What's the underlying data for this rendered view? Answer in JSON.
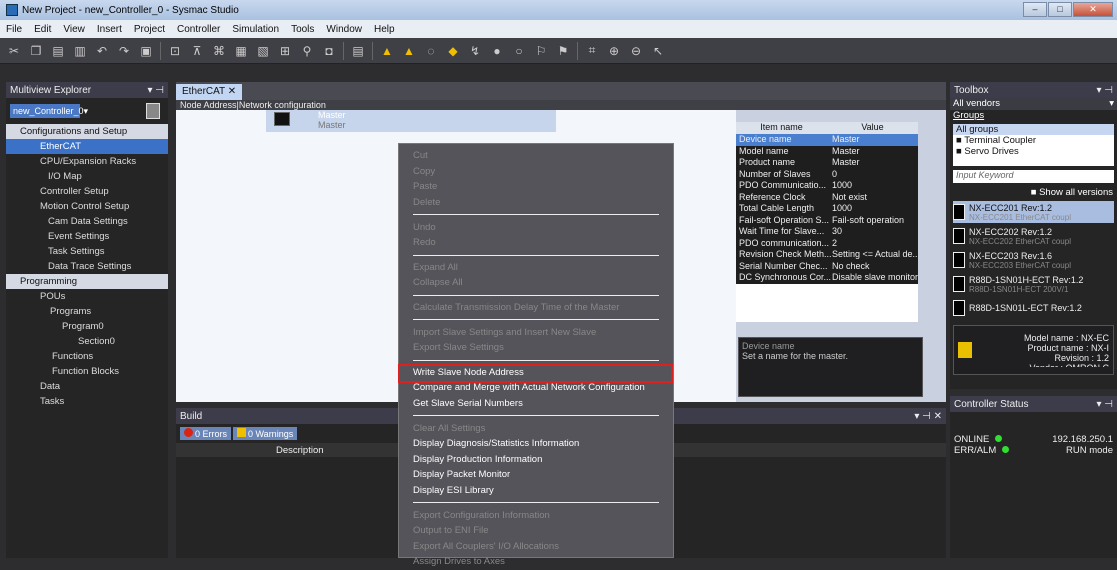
{
  "window": {
    "title": "New Project - new_Controller_0 - Sysmac Studio"
  },
  "menu": [
    "File",
    "Edit",
    "View",
    "Insert",
    "Project",
    "Controller",
    "Simulation",
    "Tools",
    "Window",
    "Help"
  ],
  "multiview": {
    "title": "Multiview Explorer",
    "controller": "new_Controller_0",
    "items": [
      {
        "label": "Configurations and Setup",
        "type": "section"
      },
      {
        "label": "EtherCAT",
        "type": "selected",
        "indent": 34
      },
      {
        "label": "CPU/Expansion Racks",
        "indent": 34
      },
      {
        "label": "I/O Map",
        "indent": 42
      },
      {
        "label": "Controller Setup",
        "indent": 34
      },
      {
        "label": "Motion Control Setup",
        "indent": 34
      },
      {
        "label": "Cam Data Settings",
        "indent": 42
      },
      {
        "label": "Event Settings",
        "indent": 42
      },
      {
        "label": "Task Settings",
        "indent": 42
      },
      {
        "label": "Data Trace Settings",
        "indent": 42
      },
      {
        "label": "Programming",
        "type": "section"
      },
      {
        "label": "POUs",
        "indent": 34
      },
      {
        "label": "Programs",
        "indent": 44
      },
      {
        "label": "Program0",
        "indent": 56
      },
      {
        "label": "Section0",
        "indent": 72
      },
      {
        "label": "Functions",
        "indent": 46
      },
      {
        "label": "Function Blocks",
        "indent": 46
      },
      {
        "label": "Data",
        "indent": 34
      },
      {
        "label": "Tasks",
        "indent": 34
      }
    ]
  },
  "editor": {
    "tab": "EtherCAT",
    "header": "Node Address|Network configuration",
    "master_label": "Master",
    "master_sub": "Master",
    "props_headers": [
      "Item name",
      "Value"
    ],
    "props": [
      {
        "k": "Device name",
        "v": "Master",
        "sel": true
      },
      {
        "k": "Model name",
        "v": "Master"
      },
      {
        "k": "Product name",
        "v": "Master"
      },
      {
        "k": "Number of Slaves",
        "v": "0"
      },
      {
        "k": "PDO Communicatio...",
        "v": "1000"
      },
      {
        "k": "Reference Clock",
        "v": "Not exist"
      },
      {
        "k": "Total Cable Length",
        "v": "1000"
      },
      {
        "k": "Fail-soft Operation S...",
        "v": "Fail-soft operation"
      },
      {
        "k": "Wait Time for Slave...",
        "v": "30"
      },
      {
        "k": "PDO communication...",
        "v": "2"
      },
      {
        "k": "Revision Check Meth...",
        "v": "Setting <= Actual de..."
      },
      {
        "k": "Serial Number Chec...",
        "v": "No check"
      },
      {
        "k": "DC Synchronous Cor...",
        "v": "Disable slave monitor..."
      }
    ],
    "device_name_title": "Device name",
    "device_name_desc": "Set a name for the master."
  },
  "context_menu": [
    {
      "label": "Cut",
      "en": false
    },
    {
      "label": "Copy",
      "en": false
    },
    {
      "label": "Paste",
      "en": false
    },
    {
      "label": "Delete",
      "en": false
    },
    {
      "sep": true
    },
    {
      "label": "Undo",
      "en": false
    },
    {
      "label": "Redo",
      "en": false
    },
    {
      "sep": true
    },
    {
      "label": "Expand All",
      "en": false
    },
    {
      "label": "Collapse All",
      "en": false
    },
    {
      "sep": true
    },
    {
      "label": "Calculate Transmission Delay Time of the Master",
      "en": false
    },
    {
      "sep": true
    },
    {
      "label": "Import Slave Settings and Insert New Slave",
      "en": false
    },
    {
      "label": "Export Slave Settings",
      "en": false
    },
    {
      "sep": true
    },
    {
      "label": "Write Slave Node Address",
      "en": true
    },
    {
      "label": "Compare and Merge with Actual Network Configuration",
      "en": true
    },
    {
      "label": "Get Slave Serial Numbers",
      "en": true
    },
    {
      "sep": true
    },
    {
      "label": "Clear All Settings",
      "en": false
    },
    {
      "label": "Display Diagnosis/Statistics Information",
      "en": true
    },
    {
      "label": "Display Production Information",
      "en": true
    },
    {
      "label": "Display Packet Monitor",
      "en": true
    },
    {
      "label": "Display ESI Library",
      "en": true
    },
    {
      "sep": true
    },
    {
      "label": "Export Configuration Information",
      "en": false
    },
    {
      "label": "Output to ENI File",
      "en": false
    },
    {
      "label": "Export All Couplers' I/O Allocations",
      "en": false
    },
    {
      "label": "Assign Drives to Axes",
      "en": false
    }
  ],
  "build": {
    "title": "Build",
    "errors": "0 Errors",
    "warnings": "0 Warnings",
    "col_desc": "Description"
  },
  "toolbox": {
    "title": "Toolbox",
    "vendors": "All vendors",
    "groups_label": "Groups",
    "groups": [
      "All groups",
      "Terminal Coupler",
      "Servo Drives"
    ],
    "keyword_placeholder": "Input Keyword",
    "show_all": "Show all versions",
    "devices": [
      {
        "name": "NX-ECC201 Rev:1.2",
        "sub": "NX-ECC201 EtherCAT coupl",
        "sel": true
      },
      {
        "name": "NX-ECC202 Rev:1.2",
        "sub": "NX-ECC202 EtherCAT coupl"
      },
      {
        "name": "NX-ECC203 Rev:1.6",
        "sub": "NX-ECC203 EtherCAT coupl"
      },
      {
        "name": "R88D-1SN01H-ECT Rev:1.2",
        "sub": "R88D-1SN01H-ECT 200V/1"
      },
      {
        "name": "R88D-1SN01L-ECT Rev:1.2",
        "sub": ""
      }
    ],
    "info": {
      "model": "Model name : NX-EC",
      "product": "Product name : NX-I",
      "revision": "Revision : 1.2",
      "vendor": "Vendor : OMRON C"
    }
  },
  "controller_status": {
    "title": "Controller Status",
    "online": "ONLINE",
    "ip": "192.168.250.1",
    "err": "ERR/ALM",
    "mode": "RUN mode"
  }
}
